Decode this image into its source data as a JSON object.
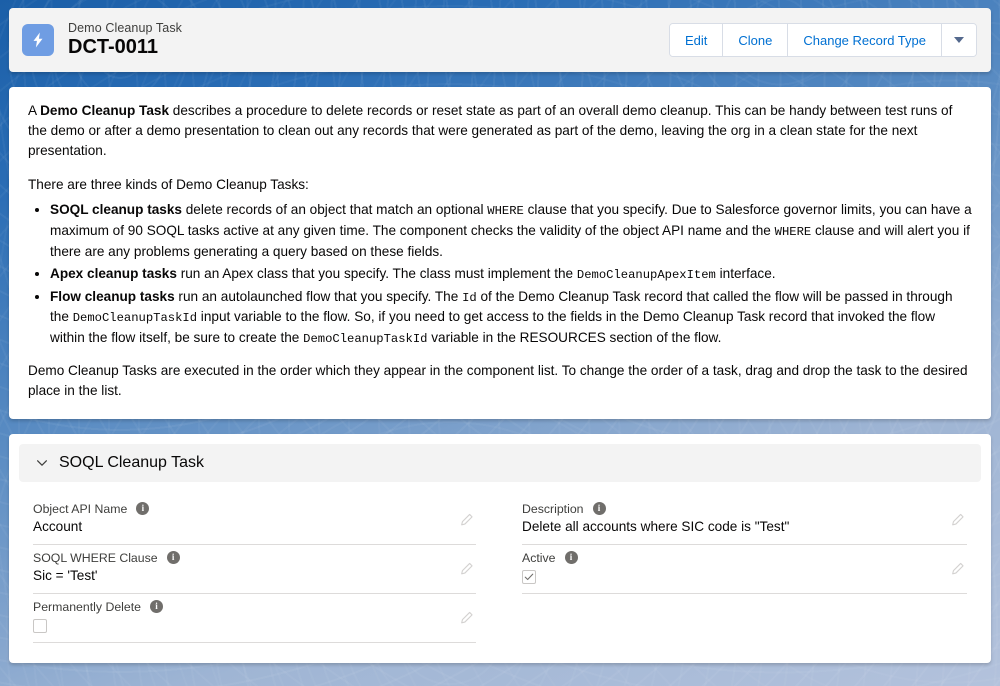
{
  "header": {
    "icon": "lightning-bolt-icon",
    "record_type": "Demo Cleanup Task",
    "record_name": "DCT-0011",
    "buttons": [
      {
        "label": "Edit",
        "name": "edit-button"
      },
      {
        "label": "Clone",
        "name": "clone-button"
      },
      {
        "label": "Change Record Type",
        "name": "change-record-type-button"
      }
    ],
    "more_actions_icon": "chevron-down-icon"
  },
  "info": {
    "para1_pre": "A ",
    "para1_bold": "Demo Cleanup Task",
    "para1_post": " describes a procedure to delete records or reset state as part of an overall demo cleanup. This can be handy between test runs of the demo or after a demo presentation to clean out any records that were generated as part of the demo, leaving the org in a clean state for the next presentation.",
    "para2": "There are three kinds of Demo Cleanup Tasks:",
    "bullets": [
      {
        "bold": "SOQL cleanup tasks",
        "t1": " delete records of an object that match an optional ",
        "code1": "WHERE",
        "t2": " clause that you specify. Due to Salesforce governor limits, you can have a maximum of 90 SOQL tasks active at any given time. The component checks the validity of the object API name and the ",
        "code2": "WHERE",
        "t3": " clause and will alert you if there are any problems generating a query based on these fields."
      },
      {
        "bold": "Apex cleanup tasks",
        "t1": " run an Apex class that you specify. The class must implement the ",
        "code1": "DemoCleanupApexItem",
        "t2": " interface.",
        "code2": "",
        "t3": ""
      },
      {
        "bold": "Flow cleanup tasks",
        "t1": " run an autolaunched flow that you specify. The ",
        "code1": "Id",
        "t2": " of the Demo Cleanup Task record that called the flow will be passed in through the ",
        "code2": "DemoCleanupTaskId",
        "t3": " input variable to the flow. So, if you need to get access to the fields in the Demo Cleanup Task record that invoked the flow within the flow itself, be sure to create the ",
        "code3": "DemoCleanupTaskId",
        "t4": " variable in the RESOURCES section of the flow."
      }
    ],
    "para3": "Demo Cleanup Tasks are executed in the order which they appear in the component list. To change the order of a task, drag and drop the task to the desired place in the list."
  },
  "section": {
    "collapse_icon": "chevron-down-icon",
    "title": "SOQL Cleanup Task",
    "left_fields": [
      {
        "label": "Object API Name",
        "value": "Account",
        "type": "text",
        "checked": false
      },
      {
        "label": "SOQL WHERE Clause",
        "value": "Sic = 'Test'",
        "type": "text",
        "checked": false
      },
      {
        "label": "Permanently Delete",
        "value": "",
        "type": "checkbox",
        "checked": false
      }
    ],
    "right_fields": [
      {
        "label": "Description",
        "value": "Delete all accounts where SIC code is \"Test\"",
        "type": "text",
        "checked": false
      },
      {
        "label": "Active",
        "value": "",
        "type": "checkbox",
        "checked": true
      }
    ],
    "info_icon": "info-icon",
    "edit_icon": "pencil-icon"
  },
  "colors": {
    "link": "#0070d2",
    "icon_blue": "#6f9de3",
    "border": "#dddbda"
  }
}
